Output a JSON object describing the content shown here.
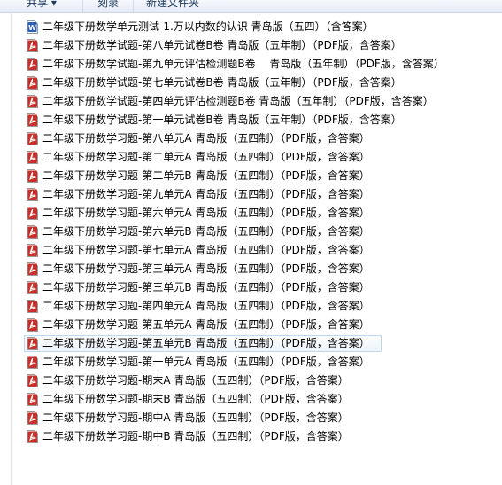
{
  "toolbar": {
    "share_label": "共享 ▾",
    "burn_label": "刻录",
    "new_folder_label": "新建文件夹"
  },
  "files": [
    {
      "name": "二年级下册数学单元测试-1.万以内数的认识 青岛版（五四）（含答案）",
      "type": "word-doc-icon"
    },
    {
      "name": "二年级下册数学试题-第八单元试卷B卷 青岛版（五年制）（PDF版，含答案）",
      "type": "pdf-icon"
    },
    {
      "name": "二年级下册数学试题-第九单元评估检测题B卷　 青岛版（五年制）（PDF版，含答案）",
      "type": "pdf-icon"
    },
    {
      "name": "二年级下册数学试题-第七单元试卷B卷 青岛版（五年制）（PDF版，含答案）",
      "type": "pdf-icon"
    },
    {
      "name": "二年级下册数学试题-第四单元评估检测题B卷 青岛版（五年制）（PDF版，含答案）",
      "type": "pdf-icon"
    },
    {
      "name": "二年级下册数学试题-第一单元试卷B卷 青岛版（五年制）（PDF版，含答案）",
      "type": "pdf-icon"
    },
    {
      "name": "二年级下册数学习题-第八单元A 青岛版（五四制）（PDF版，含答案）",
      "type": "pdf-icon"
    },
    {
      "name": "二年级下册数学习题-第二单元A 青岛版（五四制）（PDF版，含答案）",
      "type": "pdf-icon"
    },
    {
      "name": "二年级下册数学习题-第二单元B 青岛版（五四制）（PDF版，含答案）",
      "type": "pdf-icon"
    },
    {
      "name": "二年级下册数学习题-第九单元A 青岛版（五四制）（PDF版，含答案）",
      "type": "pdf-icon"
    },
    {
      "name": "二年级下册数学习题-第六单元A 青岛版（五四制）（PDF版，含答案）",
      "type": "pdf-icon"
    },
    {
      "name": "二年级下册数学习题-第六单元B 青岛版（五四制）（PDF版，含答案）",
      "type": "pdf-icon"
    },
    {
      "name": "二年级下册数学习题-第七单元A 青岛版（五四制）（PDF版，含答案）",
      "type": "pdf-icon"
    },
    {
      "name": "二年级下册数学习题-第三单元A 青岛版（五四制）（PDF版，含答案）",
      "type": "pdf-icon"
    },
    {
      "name": "二年级下册数学习题-第三单元B 青岛版（五四制）（PDF版，含答案）",
      "type": "pdf-icon"
    },
    {
      "name": "二年级下册数学习题-第四单元A 青岛版（五四制）（PDF版，含答案）",
      "type": "pdf-icon"
    },
    {
      "name": "二年级下册数学习题-第五单元A 青岛版（五四制）（PDF版，含答案）",
      "type": "pdf-icon"
    },
    {
      "name": "二年级下册数学习题-第五单元B 青岛版（五四制）（PDF版，含答案）",
      "type": "pdf-icon",
      "selected": true
    },
    {
      "name": "二年级下册数学习题-第一单元A 青岛版（五四制）（PDF版，含答案）",
      "type": "pdf-icon"
    },
    {
      "name": "二年级下册数学习题-期末A 青岛版（五四制）（PDF版，含答案）",
      "type": "pdf-icon"
    },
    {
      "name": "二年级下册数学习题-期末B 青岛版（五四制）（PDF版，含答案）",
      "type": "pdf-icon"
    },
    {
      "name": "二年级下册数学习题-期中A 青岛版（五四制）（PDF版，含答案）",
      "type": "pdf-icon"
    },
    {
      "name": "二年级下册数学习题-期中B 青岛版（五四制）（PDF版，含答案）",
      "type": "pdf-icon"
    }
  ],
  "colors": {
    "selection_border": "#c2d8ee",
    "pdf_red": "#c8312b",
    "word_blue": "#2b5fb4"
  }
}
